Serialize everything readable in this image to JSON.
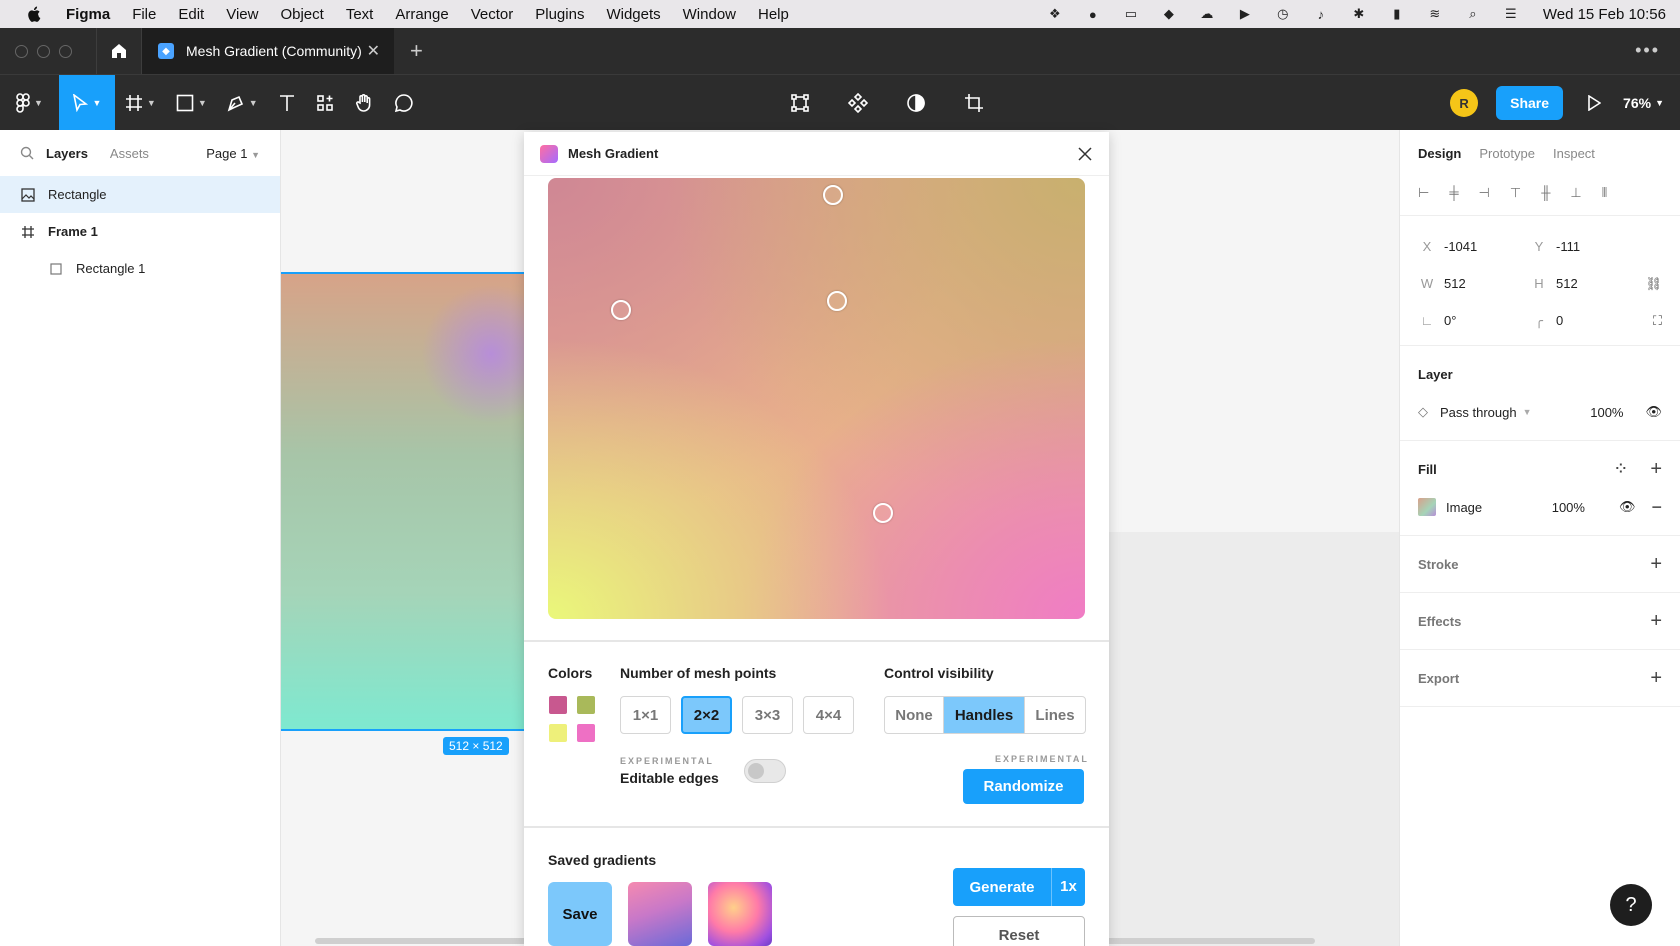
{
  "menubar": {
    "app": "Figma",
    "items": [
      "File",
      "Edit",
      "View",
      "Object",
      "Text",
      "Arrange",
      "Vector",
      "Plugins",
      "Widgets",
      "Window",
      "Help"
    ],
    "clock": "Wed 15 Feb  10:56",
    "status_icons": [
      "figma-icon",
      "grammarly-icon",
      "wd-icon",
      "dropbox-icon",
      "creative-cloud-icon",
      "play-icon",
      "time-machine-icon",
      "volume-icon",
      "bluetooth-icon",
      "battery-icon",
      "wifi-icon",
      "search-icon",
      "control-center-icon"
    ]
  },
  "tabbar": {
    "tab_title": "Mesh Gradient (Community)"
  },
  "toolbar": {
    "avatar_initial": "R",
    "share_label": "Share",
    "zoom": "76%"
  },
  "left_panel": {
    "tab_layers": "Layers",
    "tab_assets": "Assets",
    "page": "Page 1",
    "layers": [
      {
        "name": "Rectangle",
        "selected": true
      },
      {
        "name": "Frame 1",
        "selected": false
      },
      {
        "name": "Rectangle 1",
        "selected": false
      }
    ]
  },
  "canvas": {
    "size_badge": "512 × 512"
  },
  "plugin": {
    "title": "Mesh Gradient",
    "colors_label": "Colors",
    "colors": [
      "#c8588f",
      "#a9b95a",
      "#eef07a",
      "#ee70c4"
    ],
    "mesh_points_label": "Number of mesh points",
    "mesh_options": [
      "1×1",
      "2×2",
      "3×3",
      "4×4"
    ],
    "mesh_selected": "2×2",
    "visibility_label": "Control visibility",
    "visibility_options": [
      "None",
      "Handles",
      "Lines"
    ],
    "visibility_selected": "Handles",
    "experimental_1": "EXPERIMENTAL",
    "editable_edges": "Editable edges",
    "experimental_2": "EXPERIMENTAL",
    "randomize": "Randomize",
    "saved_label": "Saved gradients",
    "save": "Save",
    "generate": "Generate",
    "generate_scale": "1x",
    "reset": "Reset"
  },
  "right_panel": {
    "tabs": [
      "Design",
      "Prototype",
      "Inspect"
    ],
    "x_label": "X",
    "x": "-1041",
    "y_label": "Y",
    "y": "-111",
    "w_label": "W",
    "w": "512",
    "h_label": "H",
    "h": "512",
    "rotation": "0°",
    "radius": "0",
    "layer_label": "Layer",
    "blend": "Pass through",
    "layer_opacity": "100%",
    "fill_label": "Fill",
    "fill_type": "Image",
    "fill_opacity": "100%",
    "stroke_label": "Stroke",
    "effects_label": "Effects",
    "export_label": "Export"
  },
  "help": "?"
}
